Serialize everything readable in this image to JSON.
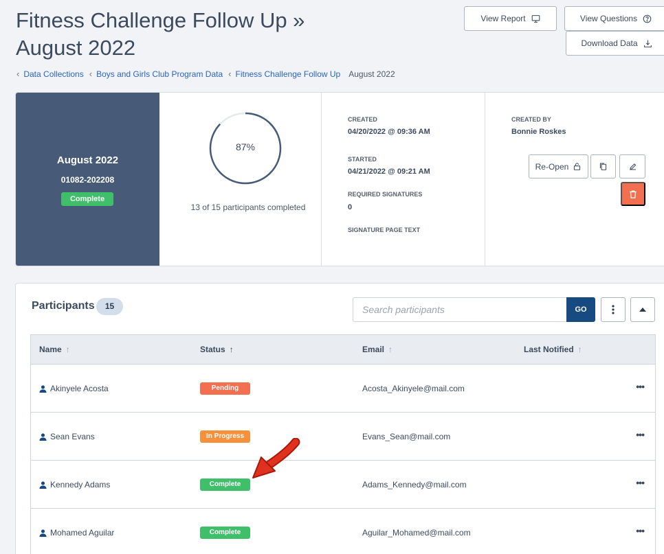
{
  "header": {
    "title_line1": "Fitness Challenge Follow Up »",
    "title_line2": "August 2022",
    "view_report": "View Report",
    "view_questions": "View Questions",
    "download_data": "Download Data"
  },
  "breadcrumb": {
    "items": [
      "Data Collections",
      "Boys and Girls Club Program Data",
      "Fitness Challenge Follow Up"
    ],
    "current": "August 2022"
  },
  "summary": {
    "name": "August 2022",
    "code": "01082-202208",
    "status": "Complete",
    "progress_percent": 87,
    "progress_label": "87%",
    "progress_caption": "13 of 15 participants completed",
    "created_label": "CREATED",
    "created_value": "04/20/2022 @ 09:36 AM",
    "started_label": "STARTED",
    "started_value": "04/21/2022 @ 09:21 AM",
    "required_signatures_label": "REQUIRED SIGNATURES",
    "required_signatures_value": "0",
    "signature_page_text_label": "SIGNATURE PAGE TEXT",
    "created_by_label": "CREATED BY",
    "created_by_value": "Bonnie Roskes",
    "reopen_label": "Re-Open"
  },
  "participants": {
    "title": "Participants",
    "count": "15",
    "search_placeholder": "Search participants",
    "go_label": "GO",
    "columns": [
      "Name",
      "Status",
      "Email",
      "Last Notified"
    ],
    "rows": [
      {
        "name": "Akinyele Acosta",
        "status": "Pending",
        "email": "Acosta_Akinyele@mail.com",
        "last_notified": ""
      },
      {
        "name": "Sean Evans",
        "status": "In Progress",
        "email": "Evans_Sean@mail.com",
        "last_notified": ""
      },
      {
        "name": "Kennedy Adams",
        "status": "Complete",
        "email": "Adams_Kennedy@mail.com",
        "last_notified": ""
      },
      {
        "name": "Mohamed Aguilar",
        "status": "Complete",
        "email": "Aguilar_Mohamed@mail.com",
        "last_notified": ""
      }
    ]
  },
  "colors": {
    "summary_bg": "#475b78",
    "complete": "#3fbf6a",
    "pending": "#f26f4f",
    "in_progress": "#f5913a",
    "go_button": "#174a80",
    "delete_button": "#f26f4f",
    "link": "#2a64c0",
    "annotation_arrow": "#e0301e"
  },
  "icons": {
    "view_report": "monitor-icon",
    "view_questions": "help-circle-icon",
    "download_data": "download-icon",
    "reopen": "unlock-icon",
    "copy": "copy-icon",
    "edit": "edit-icon",
    "delete": "trash-icon",
    "kebab": "more-vertical-icon",
    "collapse": "caret-up-icon",
    "person": "user-icon",
    "row_actions": "ellipsis-icon"
  }
}
